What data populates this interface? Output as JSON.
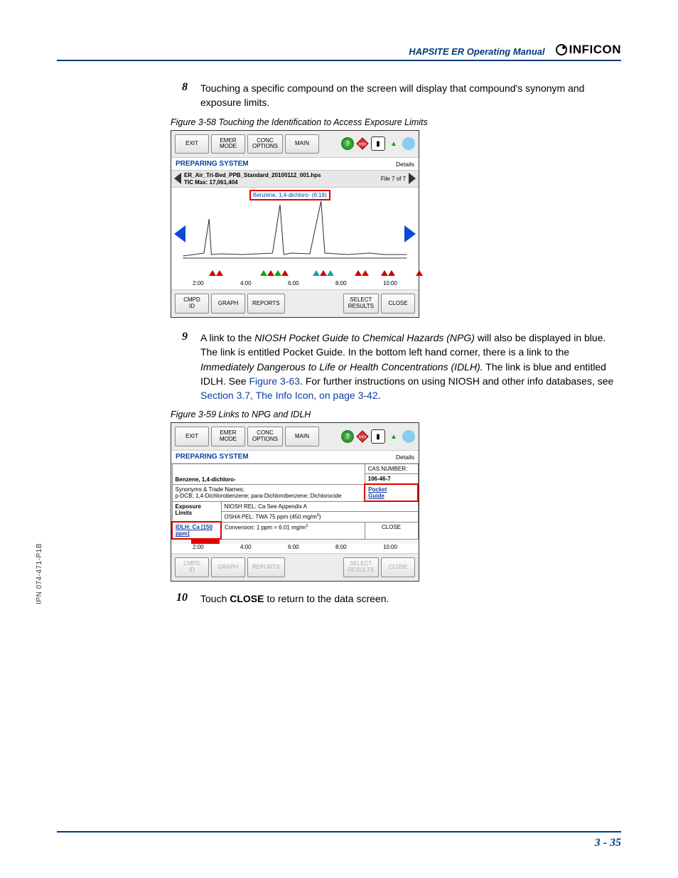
{
  "header": {
    "title": "HAPSITE ER Operating Manual",
    "logo_text": "INFICON"
  },
  "side_label": "IPN 074-471-P1B",
  "steps": {
    "s8": {
      "num": "8",
      "text": "Touching a specific compound on the screen will display that compound's synonym and exposure limits."
    },
    "s9": {
      "num": "9",
      "pre": "A link to the ",
      "em1": "NIOSH Pocket Guide to Chemical Hazards (NPG)",
      "mid1": " will also be displayed in blue. The link is entitled Pocket Guide. In the bottom left hand corner, there is a link to the ",
      "em2": "Immediately Dangerous to Life or Health Concentrations (IDLH).",
      "mid2": " The link is blue and entitled IDLH. See ",
      "link1": "Figure 3-63",
      "mid3": ". For further instructions on using NIOSH and other info databases, see ",
      "link2": "Section 3.7, The Info Icon, on page 3-42",
      "end": "."
    },
    "s10": {
      "num": "10",
      "pre": "Touch ",
      "bold": "CLOSE",
      "post": " to return to the data screen."
    }
  },
  "fig58": {
    "caption": "Figure 3-58  Touching the Identification to Access Exposure Limits",
    "top": {
      "exit": "EXIT",
      "emer": "EMER\nMODE",
      "conc": "CONC\nOPTIONS",
      "main": "MAIN"
    },
    "status": "PREPARING SYSTEM",
    "details": "Details",
    "file1": "ER_Air_Tri-Bed_PPB_Standard_20100112_001.hps",
    "file2": "TIC Max: 17,061,404",
    "filecount": "File 7 of 7",
    "tooltip": "Benzene, 1,4-dichloro- (6:18)",
    "axis": [
      "2:00",
      "4:00",
      "6:00",
      "8:00",
      "10:00"
    ],
    "bot": {
      "cmpd": "CMPD\nID",
      "graph": "GRAPH",
      "reports": "REPORTS",
      "select": "SELECT\nRESULTS",
      "close": "CLOSE"
    }
  },
  "fig59": {
    "caption": "Figure 3-59  Links to NPG and IDLH",
    "top": {
      "exit": "EXIT",
      "emer": "EMER\nMODE",
      "conc": "CONC\nOPTIONS",
      "main": "MAIN"
    },
    "status": "PREPARING SYSTEM",
    "details": "Details",
    "compound": "Benzene, 1,4-dichloro-",
    "cas_lbl": "CAS NUMBER:",
    "cas_val": "106-46-7",
    "syn_lbl": "Synonyms & Trade Names;",
    "syn_val": "p-DCB; 1,4-Dichlorobenzene; para-Dichlorobenzene; Dichlorocide",
    "pocket": "Pocket",
    "guide": "Guide",
    "exp_lbl": "Exposure Limits",
    "niosh": "NIOSH REL: Ca See Appendix A",
    "osha": "OSHA PEL: TWA 75 ppm (450 mg/m",
    "idlh": "IDLH: Ca [150 ppm]",
    "conv": "Conversion: 1 ppm = 6.01 mg/m",
    "close_sm": "CLOSE",
    "axis": [
      "2:00",
      "4:00",
      "6:00",
      "8:00",
      "10:00"
    ],
    "bot": {
      "cmpd": "CMPD\nID",
      "graph": "GRAPH",
      "reports": "REPORTS",
      "select": "SELECT\nRESULTS",
      "close": "CLOSE"
    }
  },
  "footer": {
    "page": "3 - 35"
  },
  "chart_data": {
    "type": "line",
    "x_ticks": [
      "2:00",
      "4:00",
      "6:00",
      "8:00",
      "10:00"
    ],
    "title": "TIC chromatogram",
    "ylabel": "TIC",
    "ylim_label": "TIC Max: 17,061,404",
    "peaks_approx_x": [
      1.7,
      4.7,
      6.3
    ],
    "markers_approx_x": [
      1.5,
      1.7,
      4.0,
      4.2,
      4.5,
      6.0,
      6.3,
      7.1,
      8.0,
      8.2,
      9.5
    ],
    "highlighted_peak": {
      "label": "Benzene, 1,4-dichloro-",
      "rt": "6:18"
    }
  }
}
